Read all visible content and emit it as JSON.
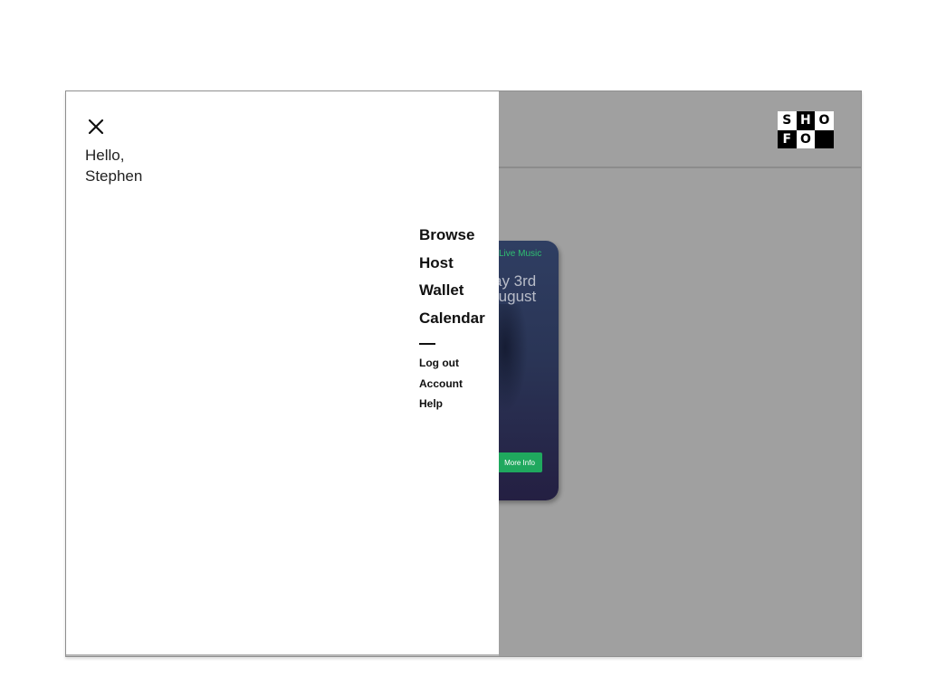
{
  "header": {
    "logo": {
      "letters": [
        "S",
        "H",
        "O",
        "F",
        "O",
        ""
      ]
    }
  },
  "event_card": {
    "tag": "Live Music",
    "date_line1": "ay 3rd",
    "date_line2": "ugust",
    "button_label": "More Info",
    "accent_color": "#1fa85e"
  },
  "drawer": {
    "close_icon": "close-icon",
    "greeting_line1": "Hello,",
    "greeting_line2": "Stephen",
    "main_items": [
      {
        "label": "Browse"
      },
      {
        "label": "Host"
      },
      {
        "label": "Wallet"
      },
      {
        "label": "Calendar"
      }
    ],
    "secondary_items": [
      {
        "label": "Log out"
      },
      {
        "label": "Account"
      },
      {
        "label": "Help"
      }
    ]
  }
}
